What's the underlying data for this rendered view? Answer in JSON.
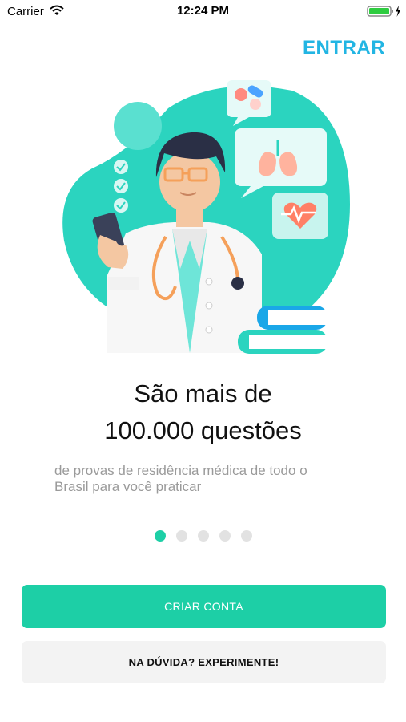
{
  "status_bar": {
    "carrier": "Carrier",
    "time": "12:24 PM"
  },
  "header": {
    "enter_label": "ENTRAR"
  },
  "slide": {
    "headline_line1": "São mais de",
    "headline_line2": "100.000 questões",
    "subtitle_line1": "de provas de residência médica de todo o",
    "subtitle_line2": "Brasil para você praticar"
  },
  "pagination": {
    "total": 5,
    "active_index": 0
  },
  "buttons": {
    "create_account": "CRIAR CONTA",
    "try_it": "NA DÚVIDA? EXPERIMENTE!"
  },
  "colors": {
    "accent": "#1dcfa6",
    "link": "#22b5e3"
  },
  "icons": [
    "wifi-icon",
    "battery-icon",
    "charging-bolt-icon",
    "doctor-illustration",
    "pills-icon",
    "lungs-icon",
    "heart-rate-icon",
    "books-icon",
    "checkmark-icon"
  ]
}
